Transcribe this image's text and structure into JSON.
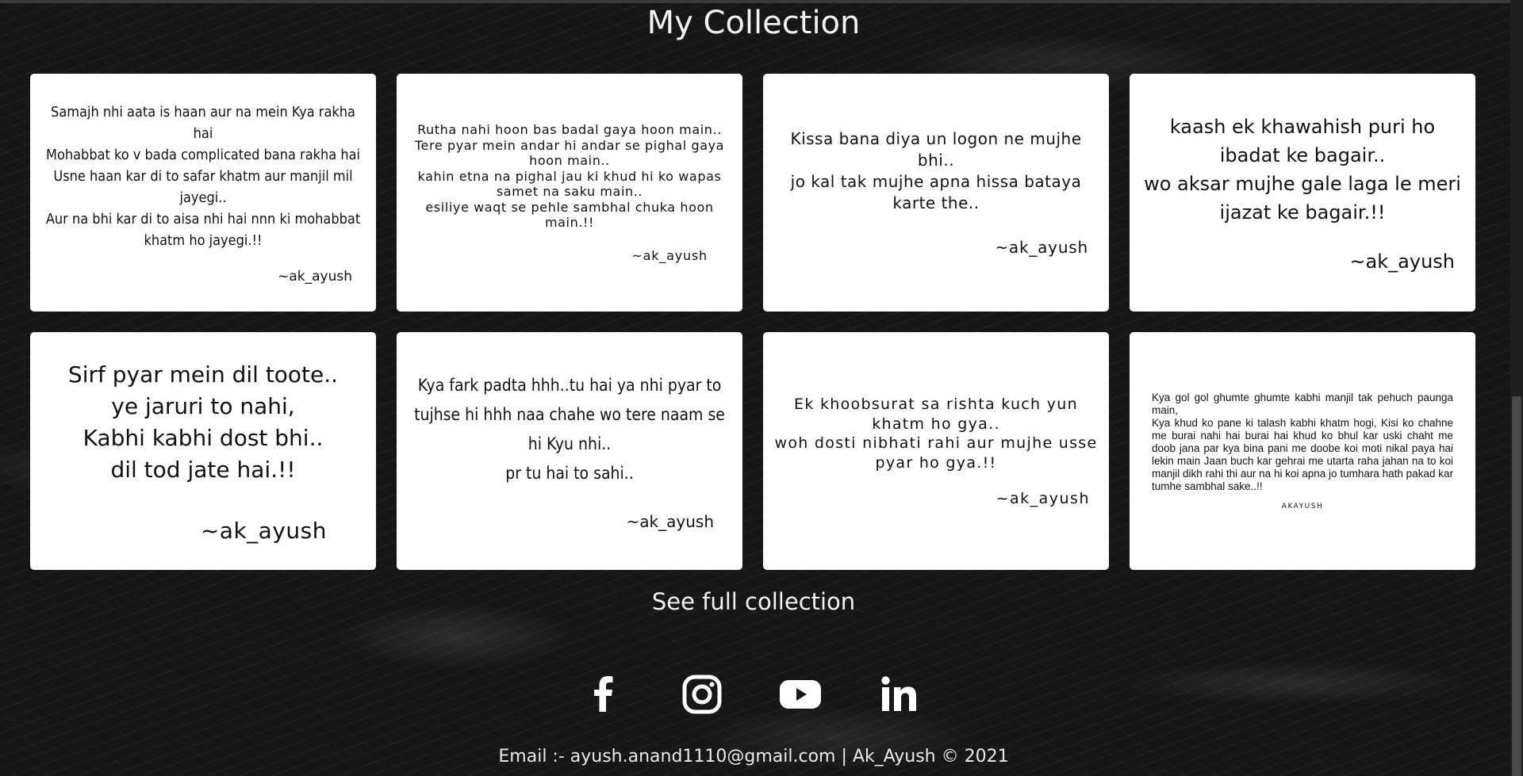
{
  "section": {
    "title": "My Collection"
  },
  "cards": [
    {
      "poem": "Samajh nhi aata is haan aur na mein Kya rakha hai\nMohabbat ko v bada complicated bana rakha hai\nUsne haan kar di to safar khatm aur manjil mil jayegi..\nAur na bhi kar di to aisa nhi hai nnn ki mohabbat khatm ho jayegi.!!",
      "sig": "~ak_ayush"
    },
    {
      "poem": "Rutha nahi hoon bas badal gaya hoon main..\nTere pyar mein andar hi andar se pighal gaya hoon main..\nkahin etna na pighal jau ki khud hi ko wapas samet na saku main..\nesiliye waqt se pehle sambhal chuka hoon main.!!",
      "sig": "~ak_ayush"
    },
    {
      "poem": "Kissa bana diya un logon ne mujhe bhi..\njo kal tak mujhe apna hissa bataya karte the..",
      "sig": "~ak_ayush"
    },
    {
      "poem": "kaash ek khawahish puri ho ibadat ke bagair..\nwo aksar mujhe gale laga le meri ijazat ke bagair.!!",
      "sig": "~ak_ayush"
    },
    {
      "poem": "Sirf pyar mein dil toote..\nye jaruri to nahi,\nKabhi kabhi dost bhi..\ndil tod jate hai.!!",
      "sig": "~ak_ayush"
    },
    {
      "poem": "Kya fark padta hhh..tu hai ya nhi pyar to tujhse hi hhh naa chahe wo tere naam se hi Kyu nhi..\npr tu hai to sahi..",
      "sig": "~ak_ayush"
    },
    {
      "poem": "Ek khoobsurat sa rishta kuch yun khatm ho gya..\nwoh dosti nibhati rahi aur mujhe usse pyar ho gya.!!",
      "sig": "~ak_ayush"
    },
    {
      "poem": "Kya gol gol ghumte ghumte kabhi manjil tak pehuch paunga main,\nKya khud ko pane ki talash kabhi khatm hogi, Kisi ko chahne me burai nahi hai burai hai khud ko bhul kar uski chaht me doob jana par kya bina pani me doobe koi moti nikal paya hai lekin main Jaan buch kar gehrai me utarta raha jahan na to koi manjil dikh rahi thi aur na hi koi apna jo tumhara hath pakad kar tumhe sambhal sake..!!",
      "sig": "AKAYUSH"
    }
  ],
  "links": {
    "see_full": "See full collection"
  },
  "social": [
    {
      "name": "facebook-icon"
    },
    {
      "name": "instagram-icon"
    },
    {
      "name": "youtube-icon"
    },
    {
      "name": "linkedin-icon"
    }
  ],
  "footer": {
    "text": "Email :- ayush.anand1110@gmail.com | Ak_Ayush © 2021"
  },
  "colors": {
    "background": "#161616",
    "card": "#ffffff",
    "text_light": "#f2f2f2",
    "text_dark": "#111111"
  }
}
